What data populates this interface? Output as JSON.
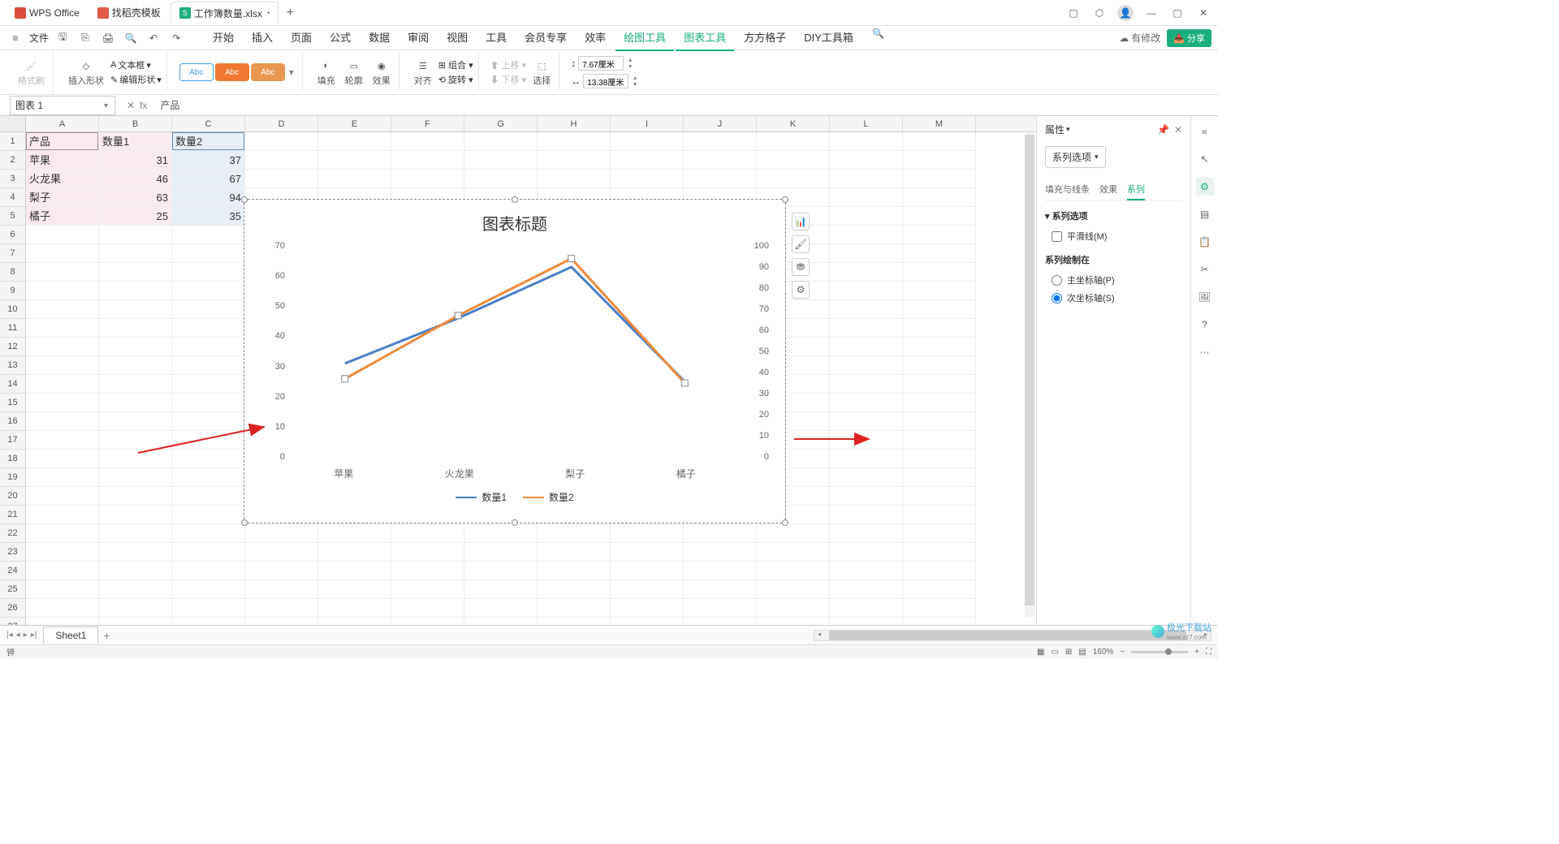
{
  "titlebar": {
    "tabs": [
      {
        "label": "WPS Office",
        "icon_color": "#d94b3a"
      },
      {
        "label": "找稻壳模板",
        "icon_color": "#e05a4a"
      },
      {
        "label": "工作簿数量.xlsx",
        "icon_color": "#1aad7e",
        "active": true,
        "dirty": "•"
      }
    ],
    "new_tab": "+"
  },
  "menurow": {
    "file": "文件",
    "ribbon_tabs": [
      "开始",
      "插入",
      "页面",
      "公式",
      "数据",
      "审阅",
      "视图",
      "工具",
      "会员专享",
      "效率",
      "绘图工具",
      "图表工具",
      "方方格子",
      "DIY工具箱"
    ],
    "active_tab": "绘图工具",
    "has_changes": "有修改",
    "share": "分享"
  },
  "ribbon": {
    "format_painter": "格式刷",
    "insert_shape": "插入形状",
    "edit_shape": "编辑形状",
    "textbox": "文本框",
    "preset_label": "Abc",
    "fill": "填充",
    "outline": "轮廓",
    "effects": "效果",
    "align": "对齐",
    "group": "组合",
    "rotate": "旋转",
    "move_up": "上移",
    "move_down": "下移",
    "select": "选择",
    "width_val": "7.67厘米",
    "height_val": "13.38厘米"
  },
  "formula_bar": {
    "namebox": "图表 1",
    "fx": "fx",
    "content": "产品"
  },
  "grid": {
    "columns": [
      "A",
      "B",
      "C",
      "D",
      "E",
      "F",
      "G",
      "H",
      "I",
      "J",
      "K",
      "L",
      "M"
    ],
    "rows_shown": 27,
    "data": [
      [
        "产品",
        "数量1",
        "数量2"
      ],
      [
        "苹果",
        "31",
        "37"
      ],
      [
        "火龙果",
        "46",
        "67"
      ],
      [
        "梨子",
        "63",
        "94"
      ],
      [
        "橘子",
        "25",
        "35"
      ]
    ]
  },
  "chart_data": {
    "type": "line",
    "title": "图表标题",
    "categories": [
      "苹果",
      "火龙果",
      "梨子",
      "橘子"
    ],
    "series": [
      {
        "name": "数量1",
        "values": [
          31,
          46,
          63,
          25
        ],
        "axis": "primary",
        "color": "#4a7ec8"
      },
      {
        "name": "数量2",
        "values": [
          37,
          67,
          94,
          35
        ],
        "axis": "secondary",
        "color": "#ee8a3a"
      }
    ],
    "y_primary": {
      "min": 0,
      "max": 70,
      "step": 10
    },
    "y_secondary": {
      "min": 0,
      "max": 100,
      "step": 10
    },
    "y_left_ticks": [
      "70",
      "60",
      "50",
      "40",
      "30",
      "20",
      "10",
      "0"
    ],
    "y_right_ticks": [
      "100",
      "90",
      "80",
      "70",
      "60",
      "50",
      "40",
      "30",
      "20",
      "10",
      "0"
    ]
  },
  "side_panel": {
    "title": "属性",
    "dropdown": "系列选项",
    "tabs": [
      "填充与线条",
      "效果",
      "系列"
    ],
    "active_tab": "系列",
    "section1": "系列选项",
    "smooth_line": "平滑线(M)",
    "section2": "系列绘制在",
    "radio_primary": "主坐标轴(P)",
    "radio_secondary": "次坐标轴(S)"
  },
  "sheet": {
    "name": "Sheet1",
    "add": "+"
  },
  "status": {
    "indicator": "钾",
    "zoom": "160%"
  },
  "watermark": {
    "brand": "极光下载站",
    "url": "www.xz7.com"
  }
}
